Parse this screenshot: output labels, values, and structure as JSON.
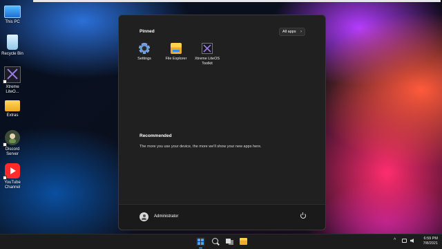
{
  "desktop": {
    "icons": [
      {
        "label": "This PC"
      },
      {
        "label": "Recycle Bin"
      },
      {
        "label": "Xtreme LiteO..."
      },
      {
        "label": "Extras"
      },
      {
        "label": "Discord Server"
      },
      {
        "label": "YouTube Channel"
      }
    ]
  },
  "start_menu": {
    "pinned_title": "Pinned",
    "all_apps_label": "All apps",
    "all_apps_chevron": "›",
    "pinned_apps": [
      {
        "label": "Settings",
        "icon": "gear-icon"
      },
      {
        "label": "File Explorer",
        "icon": "folder-icon"
      },
      {
        "label": "Xtreme LiteOS Toolkit",
        "icon": "xtreme-icon"
      }
    ],
    "recommended_title": "Recommended",
    "recommended_text": "The more you use your device, the more we'll show your new apps here.",
    "user_name": "Administrator"
  },
  "taskbar": {
    "tray_chevron": "^",
    "time": "6:59 PM",
    "date": "7/8/2021"
  },
  "colors": {
    "accent": "#4aa3ff",
    "menu_bg": "#202020",
    "taskbar_bg": "#1c1c1c"
  }
}
